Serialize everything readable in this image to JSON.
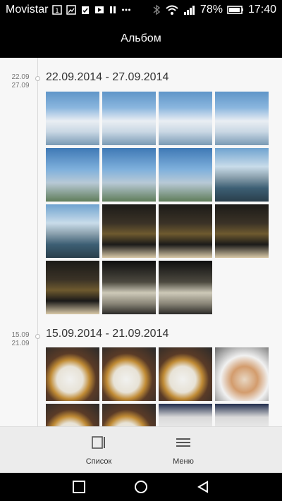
{
  "status_bar": {
    "carrier": "Movistar",
    "sim_badge": "1",
    "battery_percent": "78%",
    "time": "17:40",
    "icons": [
      "sim-icon",
      "gallery-icon",
      "clipboard-check-icon",
      "youtube-icon",
      "pause-icon",
      "more-dots-icon",
      "bluetooth-icon",
      "wifi-icon",
      "signal-icon",
      "battery-icon"
    ]
  },
  "app_bar": {
    "title": "Альбом"
  },
  "sections": [
    {
      "mini_from": "22.09",
      "mini_to": "27.09",
      "range": "22.09.2014 - 27.09.2014",
      "photos": [
        "sky",
        "sky",
        "sky",
        "sky",
        "sky2",
        "sky2",
        "sky2",
        "coast",
        "coast",
        "bar",
        "bar",
        "bar",
        "bar",
        "drink",
        "drink"
      ]
    },
    {
      "mini_from": "15.09",
      "mini_to": "21.09",
      "range": "15.09.2014 - 21.09.2014",
      "photos": [
        "food",
        "food",
        "food",
        "pasta",
        "food",
        "food",
        "menu",
        "menu"
      ]
    }
  ],
  "bottom_bar": {
    "list_label": "Список",
    "menu_label": "Меню"
  },
  "system_nav": {
    "icons": [
      "back-square-icon",
      "home-circle-icon",
      "back-triangle-icon"
    ]
  }
}
